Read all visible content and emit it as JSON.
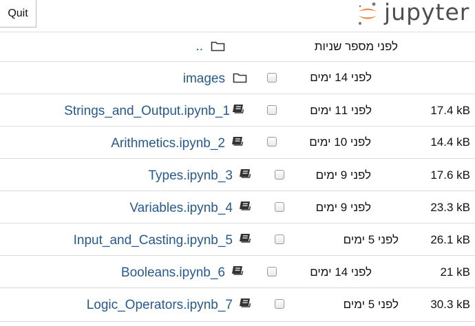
{
  "header": {
    "quit_label": "Quit",
    "logo_text": "jupyter"
  },
  "parent_row": {
    "name": "..",
    "date": "לפני מספר שניות"
  },
  "files": [
    {
      "name": "images",
      "type": "folder",
      "date": "לפני 14 ימים",
      "size": ""
    },
    {
      "name": "Strings_and_Output.ipynb_1",
      "type": "notebook",
      "date": "לפני 11 ימים",
      "size": "17.4 kB"
    },
    {
      "name": "Arithmetics.ipynb_2",
      "type": "notebook",
      "date": "לפני 10 ימים",
      "size": "14.4 kB"
    },
    {
      "name": "Types.ipynb_3",
      "type": "notebook",
      "date": "לפני 9 ימים",
      "size": "17.6 kB"
    },
    {
      "name": "Variables.ipynb_4",
      "type": "notebook",
      "date": "לפני 9 ימים",
      "size": "23.3 kB"
    },
    {
      "name": "Input_and_Casting.ipynb_5",
      "type": "notebook",
      "date": "לפני 5 ימים",
      "size": "26.1 kB"
    },
    {
      "name": "Booleans.ipynb_6",
      "type": "notebook",
      "date": "לפני 14 ימים",
      "size": "21 kB"
    },
    {
      "name": "Logic_Operators.ipynb_7",
      "type": "notebook",
      "date": "לפני 5 ימים",
      "size": "30.3 kB"
    }
  ],
  "colors": {
    "link": "#235a94",
    "logo_orange": "#f37726"
  }
}
